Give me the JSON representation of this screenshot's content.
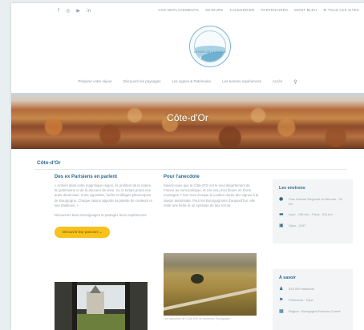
{
  "topbar": {
    "social_icons": [
      "f",
      "◎",
      "▶",
      "in"
    ],
    "links": [
      "VOS DEPLACEMENTS",
      "SEJOURS",
      "CALENDRIER",
      "PARTENAIRES",
      "MONT BLEU",
      "⚙ TOUS LES SITES"
    ]
  },
  "logo": {
    "text": "LE PARC DE LA MARINE"
  },
  "nav": {
    "items": [
      "Préparer votre séjour",
      "Découvrir les paysages",
      "Les vignes & Patrimoine",
      "Les bonnes expériences",
      "Accès"
    ],
    "search_icon": "search-icon"
  },
  "hero": {
    "title": "Côte-d'Or"
  },
  "breadcrumb": "Côte-d'Or",
  "col1": {
    "title": "Des ex Parisiens en parlent",
    "p1": "« Arrivés dans cette magnifique région, ils profitent de la nature, du patrimoine et de la douceur de vivre. Ici, le temps prend une autre dimension, entre vignobles, forêts et villages pittoresques de Bourgogne. Chaque saison apporte sa palette de couleurs et ses traditions. »",
    "p2": "Découvrez leurs témoignages et partagez leurs expériences.",
    "button": "Découvrir leur parcours ⌄"
  },
  "col2": {
    "title": "Pour l'anecdote",
    "p1": "Saviez-vous que la Côte-d'Or est le seul département de France au nom poétique, et non issu d'un fleuve ou d'une montagne ? Son nom évoque la couleur dorée des vignes à la saison automnale. Pour les Bourguignons d'aujourd'hui, elle reste une fierté et un symbole de leur terroir.",
    "caption": "Les vignobles de Côte-d'Or en automne, Bourgogne"
  },
  "env": {
    "title": "Les environs",
    "rows": [
      {
        "icon": "location-icon",
        "text": "Parc Naturel Régional du Morvan : 30 km"
      },
      {
        "icon": "car-icon",
        "text": "Lyon : 196 km – Paris : 311 km"
      },
      {
        "icon": "train-icon",
        "text": "Dijon : 2h37"
      }
    ]
  },
  "savoir": {
    "title": "À savoir",
    "rows": [
      {
        "icon": "people-icon",
        "text": "533 000 habitants"
      },
      {
        "icon": "flag-icon",
        "text": "Préfecture : Dijon"
      },
      {
        "icon": "map-icon",
        "text": "Région : Bourgogne-Franche-Comté"
      }
    ]
  },
  "colors": {
    "accent": "#2d6c8e",
    "button": "#f6c21b",
    "card_bg": "#f2f4f5"
  }
}
